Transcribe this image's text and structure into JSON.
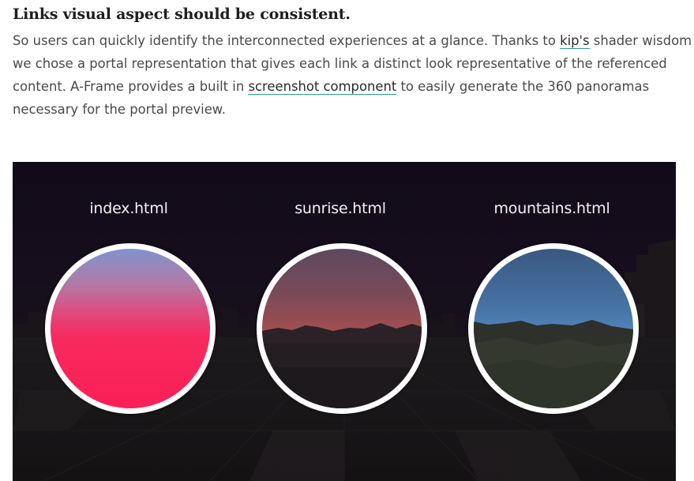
{
  "article": {
    "heading": "Links visual aspect should be consistent.",
    "line1_text": "So users can quickly identify the interconnected experiences at a glance. Thanks to ",
    "line1_link": "kip's",
    "line1_after": " shader wisdom",
    "line2": "we chose a portal representation that gives each link a distinct look representative of the referenced",
    "line3_before": "content. A-Frame provides a built in ",
    "line3_link": "screenshot component",
    "line3_after": " to easily generate the 360 panoramas",
    "line4": "necessary for the portal preview."
  },
  "scene": {
    "portals": [
      {
        "label": "index.html"
      },
      {
        "label": "sunrise.html"
      },
      {
        "label": "mountains.html"
      }
    ]
  },
  "colors": {
    "link_underline": "#2f9a92",
    "scene_bg": "#140d1b",
    "index_portal": "#fb1f56",
    "sunrise_portal": "#d8583f",
    "mountains_portal": "#5a93cc"
  }
}
